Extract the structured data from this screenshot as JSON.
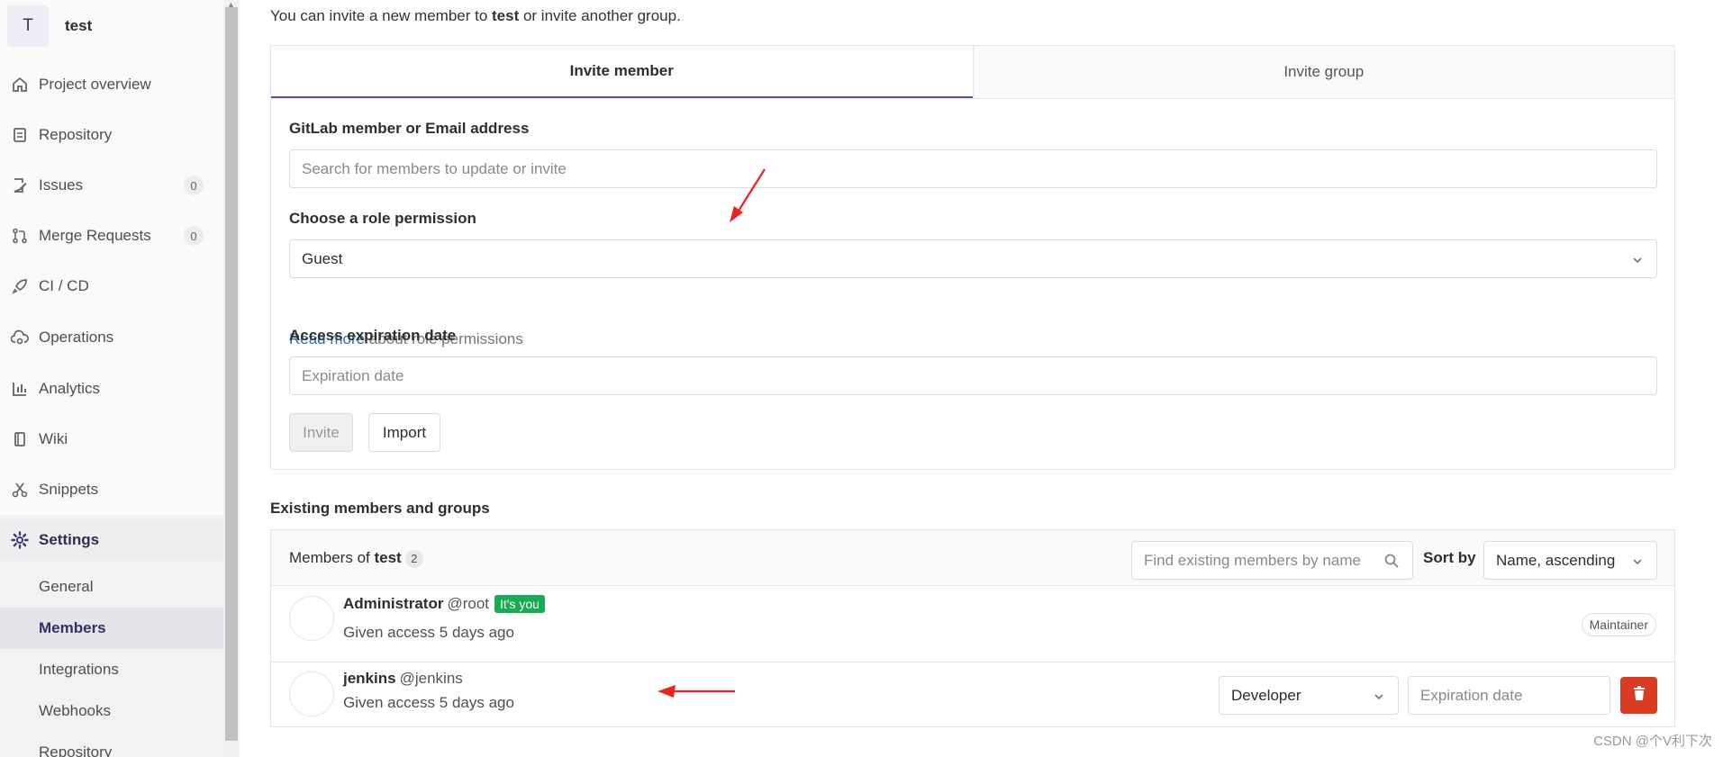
{
  "project": {
    "initial": "T",
    "name": "test"
  },
  "sidebar": {
    "items": [
      {
        "label": "Project overview",
        "icon": "home-icon"
      },
      {
        "label": "Repository",
        "icon": "document-icon"
      },
      {
        "label": "Issues",
        "icon": "issues-icon",
        "count": "0"
      },
      {
        "label": "Merge Requests",
        "icon": "merge-request-icon",
        "count": "0"
      },
      {
        "label": "CI / CD",
        "icon": "rocket-icon"
      },
      {
        "label": "Operations",
        "icon": "cloud-gear-icon"
      },
      {
        "label": "Analytics",
        "icon": "chart-icon"
      },
      {
        "label": "Wiki",
        "icon": "book-icon"
      },
      {
        "label": "Snippets",
        "icon": "scissors-icon"
      },
      {
        "label": "Settings",
        "icon": "gear-icon"
      }
    ],
    "settings_sub": [
      "General",
      "Members",
      "Integrations",
      "Webhooks",
      "Repository"
    ]
  },
  "intro": {
    "prefix": "You can invite a new member to ",
    "project": "test",
    "suffix": " or invite another group."
  },
  "tabs": {
    "member": "Invite member",
    "group": "Invite group"
  },
  "form": {
    "member_label": "GitLab member or Email address",
    "member_placeholder": "Search for members to update or invite",
    "role_label": "Choose a role permission",
    "role_value": "Guest",
    "help_link": "Read more",
    "help_text": " about role permissions",
    "expiry_label": "Access expiration date",
    "expiry_placeholder": "Expiration date",
    "invite_button": "Invite",
    "import_button": "Import"
  },
  "existing": {
    "heading": "Existing members and groups",
    "members_of": "Members of ",
    "project": "test",
    "count": "2",
    "search_placeholder": "Find existing members by name",
    "sort_label": "Sort by",
    "sort_value": "Name, ascending"
  },
  "members": [
    {
      "name": "Administrator",
      "username": "@root",
      "badge": "It's you",
      "meta": "Given access 5 days ago",
      "role": "Maintainer"
    },
    {
      "name": "jenkins",
      "username": "@jenkins",
      "meta": "Given access 5 days ago",
      "role": "Developer",
      "expiry_placeholder": "Expiration date"
    }
  ],
  "colors": {
    "accent": "#5451b0",
    "link": "#1f6fbf",
    "success": "#1aaa55",
    "danger": "#db3b21",
    "annotation": "#e8241c"
  },
  "watermark": "CSDN @个V利下次"
}
